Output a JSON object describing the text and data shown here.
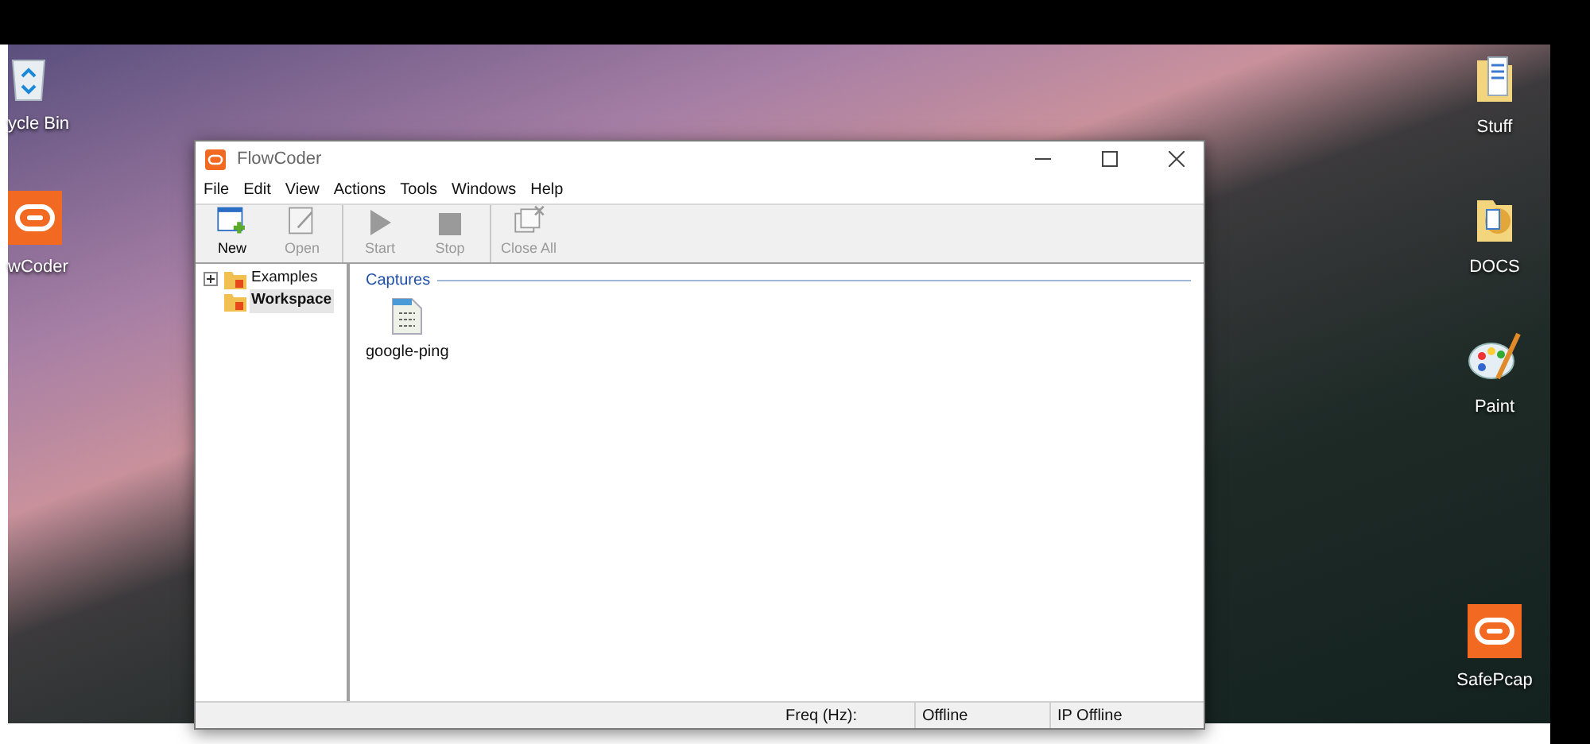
{
  "desktop_icons": [
    {
      "label": "ycle Bin",
      "kind": "recycle-bin"
    },
    {
      "label": "wCoder",
      "kind": "app"
    },
    {
      "label": "Stuff",
      "kind": "folder"
    },
    {
      "label": "DOCS",
      "kind": "folder-docs"
    },
    {
      "label": "Paint",
      "kind": "paint"
    },
    {
      "label": "SafePcap",
      "kind": "app"
    }
  ],
  "window": {
    "title": "FlowCoder",
    "menu": [
      "File",
      "Edit",
      "View",
      "Actions",
      "Tools",
      "Windows",
      "Help"
    ],
    "toolbar": [
      [
        {
          "label": "New",
          "kind": "new",
          "disabled": false
        },
        {
          "label": "Open",
          "kind": "open",
          "disabled": true
        }
      ],
      [
        {
          "label": "Start",
          "kind": "start",
          "disabled": true
        },
        {
          "label": "Stop",
          "kind": "stop",
          "disabled": true
        }
      ],
      [
        {
          "label": "Close All",
          "kind": "close-all",
          "disabled": true
        }
      ]
    ],
    "tree": [
      {
        "label": "Examples",
        "selected": false,
        "expanded": false
      },
      {
        "label": "Workspace",
        "selected": true
      }
    ],
    "group": {
      "title": "Captures",
      "items": [
        {
          "label": "google-ping"
        }
      ]
    },
    "status_bar": [
      "Freq (Hz):",
      "Offline",
      "IP Offline"
    ]
  }
}
